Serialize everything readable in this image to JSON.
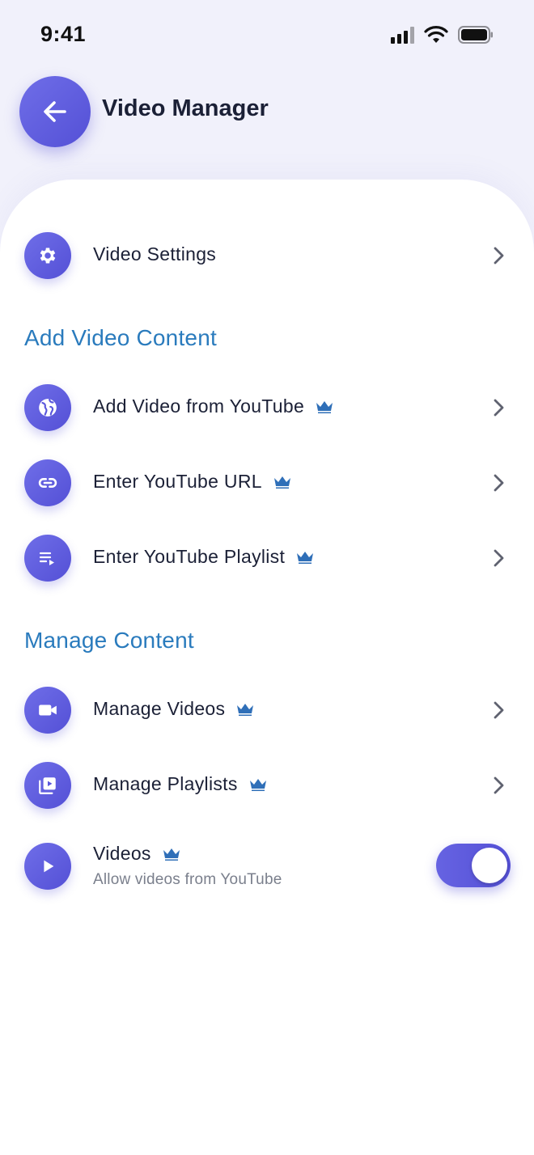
{
  "status_bar": {
    "time": "9:41"
  },
  "header": {
    "title": "Video Manager"
  },
  "rows": {
    "video_settings": {
      "label": "Video Settings"
    },
    "add_from_youtube": {
      "label": "Add Video from YouTube"
    },
    "enter_url": {
      "label": "Enter YouTube URL"
    },
    "enter_playlist": {
      "label": "Enter YouTube Playlist"
    },
    "manage_videos": {
      "label": "Manage Videos"
    },
    "manage_playlists": {
      "label": "Manage Playlists"
    },
    "videos_toggle": {
      "label": "Videos",
      "sublabel": "Allow videos from YouTube",
      "enabled": true
    }
  },
  "sections": {
    "add_content": "Add Video Content",
    "manage_content": "Manage Content"
  },
  "colors": {
    "accent": "#5a57dc",
    "section_title": "#2a7bbd",
    "crown": "#2f6fb8"
  }
}
